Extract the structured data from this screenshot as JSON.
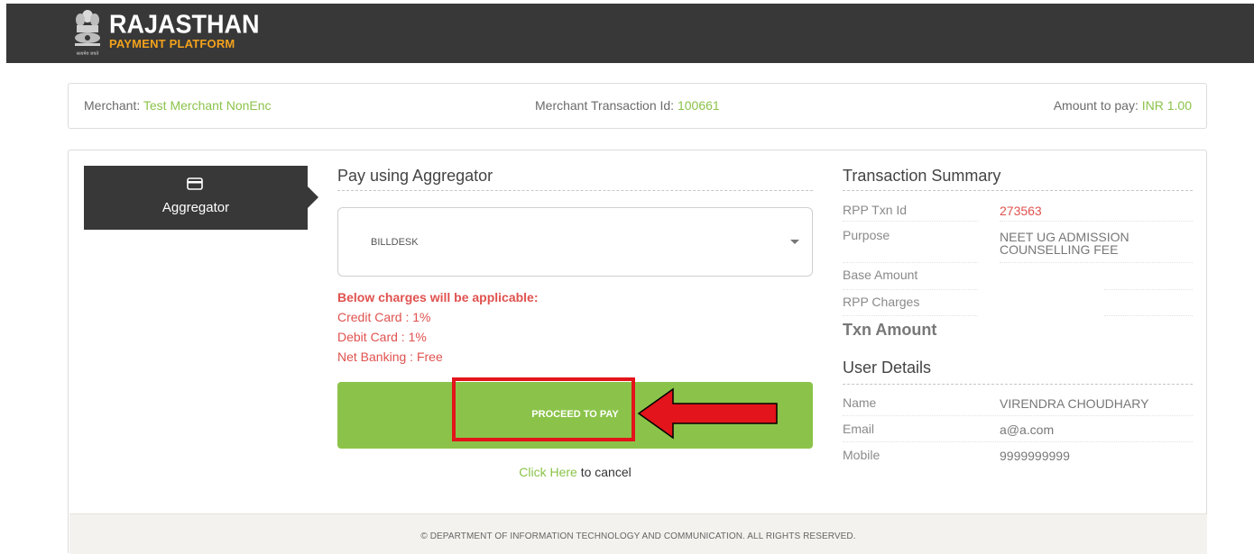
{
  "header": {
    "logo_title": "RAJASTHAN",
    "logo_subtitle": "PAYMENT PLATFORM",
    "emblem_icon": "state-emblem-icon",
    "emblem_motto": "सत्यमेव जयते"
  },
  "merchant_bar": {
    "merchant_label": "Merchant: ",
    "merchant_value": "Test Merchant NonEnc",
    "txn_label": "Merchant Transaction Id: ",
    "txn_value": "100661",
    "amount_label": "Amount to pay: ",
    "amount_value": "INR 1.00"
  },
  "sidebar": {
    "tab_label": "Aggregator",
    "tab_icon": "credit-card-icon"
  },
  "payment": {
    "title": "Pay using Aggregator",
    "selected_aggregator": "BILLDESK",
    "charges_heading": "Below charges will be applicable:",
    "charges": [
      "Credit Card : 1%",
      "Debit Card : 1%",
      "Net Banking : Free"
    ],
    "proceed_label": "PROCEED TO PAY",
    "cancel_link": "Click Here",
    "cancel_suffix": " to cancel"
  },
  "annotation": {
    "highlight_color": "#e3141b",
    "arrow_icon": "left-arrow-icon"
  },
  "summary": {
    "title": "Transaction Summary",
    "rpp_txn_label": "RPP Txn Id",
    "rpp_txn_value": "273563",
    "purpose_label": "Purpose",
    "purpose_value": "NEET UG ADMISSION COUNSELLING FEE",
    "base_amount_label": "Base Amount",
    "rpp_charges_label": "RPP Charges",
    "txn_amount_label": "Txn Amount"
  },
  "user": {
    "title": "User Details",
    "name_label": "Name",
    "name_value": "VIRENDRA CHOUDHARY",
    "email_label": "Email",
    "email_value": "a@a.com",
    "mobile_label": "Mobile",
    "mobile_value": "9999999999"
  },
  "footer": {
    "text": "© DEPARTMENT OF INFORMATION TECHNOLOGY AND COMMUNICATION. ALL RIGHTS RESERVED."
  },
  "colors": {
    "topbar": "#383838",
    "accent_green": "#8bc34a",
    "alert_red": "#e0524f",
    "logo_orange": "#f2a21c"
  }
}
